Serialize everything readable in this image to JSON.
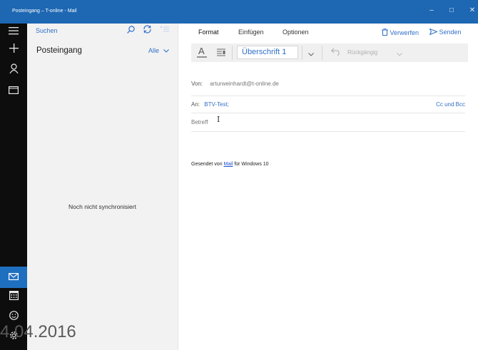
{
  "window": {
    "title": "Posteingang – T-online - Mail",
    "controls": [
      "–",
      "☐",
      "✕"
    ]
  },
  "rail": {
    "icons": [
      "hamburger-icon",
      "plus-icon",
      "person-icon",
      "folder-icon",
      "mail-icon",
      "calendar-icon",
      "smiley-icon",
      "gear-icon"
    ]
  },
  "folder_pane": {
    "search_label": "Suchen",
    "folder_title": "Posteingang",
    "filter_label": "Alle",
    "empty_message": "Noch nicht synchronisiert"
  },
  "compose": {
    "tabs": [
      "Format",
      "Einfügen",
      "Optionen"
    ],
    "discard_label": "Verwerfen",
    "send_label": "Senden",
    "style_value": "Überschrift 1",
    "undo_label": "Rückgängig",
    "from_label": "Von:",
    "from_value": "arturweinhardt@t-online.de",
    "to_label": "An:",
    "to_value": "BTV-Test;",
    "cc_bcc_label": "Cc und Bcc",
    "subject_placeholder": "Betreff",
    "signature_prefix": "Gesendet von ",
    "signature_link": "Mail",
    "signature_suffix": " für Windows 10"
  },
  "watermark": {
    "date_text": "4.04.2016"
  },
  "colors": {
    "accent": "#3070c8",
    "titlebar": "#1d67b3",
    "rail": "#0d0d0d"
  }
}
